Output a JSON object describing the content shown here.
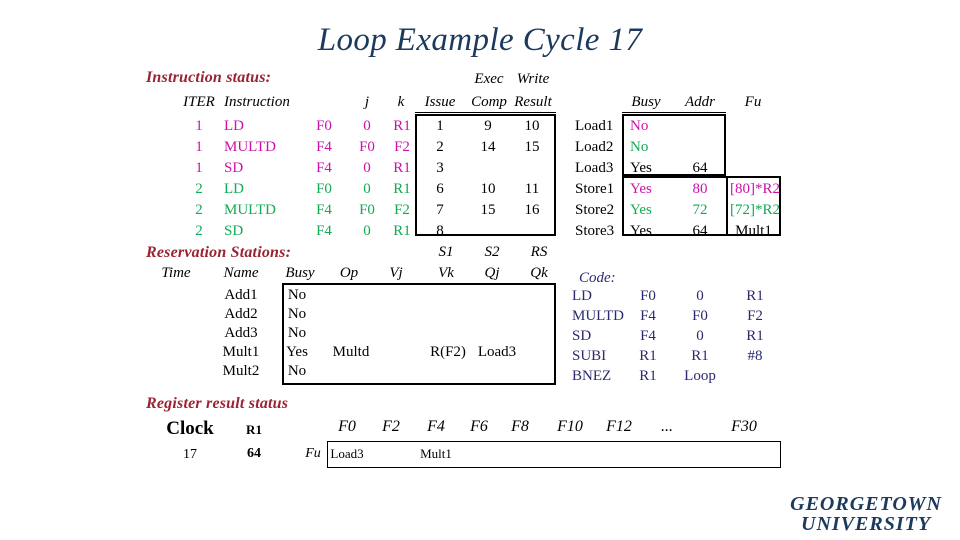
{
  "slide": {
    "title": "Loop Example Cycle 17",
    "footer_logo_line1": "GEORGETOWN",
    "footer_logo_line2": "UNIVERSITY"
  },
  "colors": {
    "title": "#1b3a5c",
    "section_heading": "#992233",
    "iteration1": "#cc11aa",
    "iteration2": "#11aa55",
    "code": "#2a2a6e",
    "default_text": "#000000"
  },
  "instruction_status": {
    "heading": "Instruction status:",
    "group_headers": {
      "exec": "Exec",
      "write": "Write"
    },
    "headers": {
      "iter": "ITER",
      "instruction": "Instruction",
      "j": "j",
      "k": "k",
      "issue": "Issue",
      "exec_comp": "Comp",
      "write_result": "Result"
    },
    "rows": [
      {
        "iter": "1",
        "instruction": "LD",
        "dest": "F0",
        "j": "0",
        "k": "R1",
        "issue": "1",
        "comp": "9",
        "result": "10",
        "color": "iteration1"
      },
      {
        "iter": "1",
        "instruction": "MULTD",
        "dest": "F4",
        "j": "F0",
        "k": "F2",
        "issue": "2",
        "comp": "14",
        "result": "15",
        "color": "iteration1"
      },
      {
        "iter": "1",
        "instruction": "SD",
        "dest": "F4",
        "j": "0",
        "k": "R1",
        "issue": "3",
        "comp": "",
        "result": "",
        "color": "iteration1"
      },
      {
        "iter": "2",
        "instruction": "LD",
        "dest": "F0",
        "j": "0",
        "k": "R1",
        "issue": "6",
        "comp": "10",
        "result": "11",
        "color": "iteration2"
      },
      {
        "iter": "2",
        "instruction": "MULTD",
        "dest": "F4",
        "j": "F0",
        "k": "F2",
        "issue": "7",
        "comp": "15",
        "result": "16",
        "color": "iteration2"
      },
      {
        "iter": "2",
        "instruction": "SD",
        "dest": "F4",
        "j": "0",
        "k": "R1",
        "issue": "8",
        "comp": "",
        "result": "",
        "color": "iteration2"
      }
    ]
  },
  "load_store_units": {
    "headers": {
      "busy": "Busy",
      "addr": "Addr",
      "fu": "Fu"
    },
    "rows": [
      {
        "name": "Load1",
        "busy": "No",
        "addr": "",
        "fu": "",
        "color": "iteration1"
      },
      {
        "name": "Load2",
        "busy": "No",
        "addr": "",
        "fu": "",
        "color": "iteration2"
      },
      {
        "name": "Load3",
        "busy": "Yes",
        "addr": "64",
        "fu": "",
        "color": "default_text"
      },
      {
        "name": "Store1",
        "busy": "Yes",
        "addr": "80",
        "fu": "[80]*R2",
        "color": "iteration1"
      },
      {
        "name": "Store2",
        "busy": "Yes",
        "addr": "72",
        "fu": "[72]*R2",
        "color": "iteration2"
      },
      {
        "name": "Store3",
        "busy": "Yes",
        "addr": "64",
        "fu": "Mult1",
        "color": "default_text"
      }
    ]
  },
  "reservation_stations": {
    "heading": "Reservation Stations:",
    "group_headers": {
      "s1": "S1",
      "s2": "S2",
      "rs": "RS"
    },
    "headers": {
      "time": "Time",
      "name": "Name",
      "busy": "Busy",
      "op": "Op",
      "vj": "Vj",
      "vk": "Vk",
      "qj": "Qj",
      "qk": "Qk"
    },
    "rows": [
      {
        "time": "",
        "name": "Add1",
        "busy": "No",
        "op": "",
        "vj": "",
        "vk": "",
        "qj": "",
        "qk": ""
      },
      {
        "time": "",
        "name": "Add2",
        "busy": "No",
        "op": "",
        "vj": "",
        "vk": "",
        "qj": "",
        "qk": ""
      },
      {
        "time": "",
        "name": "Add3",
        "busy": "No",
        "op": "",
        "vj": "",
        "vk": "",
        "qj": "",
        "qk": ""
      },
      {
        "time": "",
        "name": "Mult1",
        "busy": "Yes",
        "op": "Multd",
        "vj": "",
        "vk": "R(F2)",
        "qj": "Load3",
        "qk": ""
      },
      {
        "time": "",
        "name": "Mult2",
        "busy": "No",
        "op": "",
        "vj": "",
        "vk": "",
        "qj": "",
        "qk": ""
      }
    ]
  },
  "code": {
    "heading": "Code:",
    "lines": [
      {
        "op": "LD",
        "a": "F0",
        "b": "0",
        "c": "R1"
      },
      {
        "op": "MULTD",
        "a": "F4",
        "b": "F0",
        "c": "F2"
      },
      {
        "op": "SD",
        "a": "F4",
        "b": "0",
        "c": "R1"
      },
      {
        "op": "SUBI",
        "a": "R1",
        "b": "R1",
        "c": "#8"
      },
      {
        "op": "BNEZ",
        "a": "R1",
        "b": "Loop",
        "c": ""
      }
    ]
  },
  "register_result_status": {
    "heading": "Register result status",
    "clock_label": "Clock",
    "r1_label": "R1",
    "fu_label": "Fu",
    "clock_value": "17",
    "r1_value": "64",
    "register_headers": [
      "F0",
      "F2",
      "F4",
      "F6",
      "F8",
      "F10",
      "F12",
      "...",
      "F30"
    ],
    "fu_values": [
      "Load3",
      "",
      "Mult1",
      "",
      "",
      "",
      "",
      "",
      ""
    ]
  }
}
